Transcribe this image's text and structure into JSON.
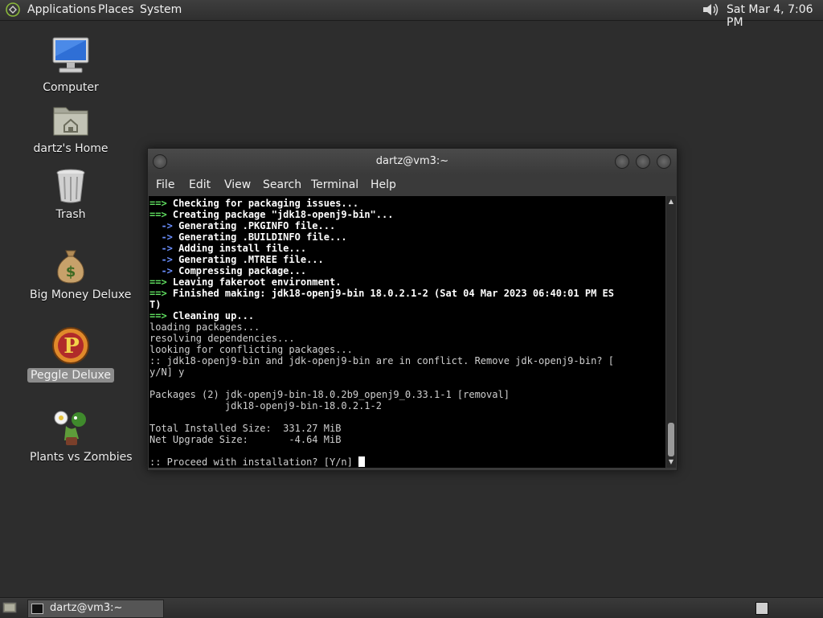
{
  "top_panel": {
    "menus": [
      "Applications",
      "Places",
      "System"
    ],
    "clock": "Sat Mar  4,  7:06 PM",
    "volume_icon": "speaker-icon"
  },
  "desktop_icons": [
    {
      "label": "Computer",
      "icon": "computer-icon"
    },
    {
      "label": "dartz's Home",
      "icon": "home-folder-icon"
    },
    {
      "label": "Trash",
      "icon": "trash-icon"
    },
    {
      "label": "Big Money Deluxe",
      "icon": "money-bag-icon"
    },
    {
      "label": "Peggle Deluxe",
      "icon": "peggle-icon",
      "selected": true
    },
    {
      "label": "Plants vs Zombies",
      "icon": "plants-vs-zombies-icon"
    }
  ],
  "terminal": {
    "title": "dartz@vm3:~",
    "menu": [
      "File",
      "Edit",
      "View",
      "Search",
      "Terminal",
      "Help"
    ],
    "lines": [
      {
        "prefix": "==> ",
        "prefix_color": "green",
        "text": "Checking for packaging issues...",
        "bold": true
      },
      {
        "prefix": "==> ",
        "prefix_color": "green",
        "text": "Creating package \"jdk18-openj9-bin\"...",
        "bold": true
      },
      {
        "prefix": "  -> ",
        "prefix_color": "blue",
        "text": "Generating .PKGINFO file...",
        "bold": true
      },
      {
        "prefix": "  -> ",
        "prefix_color": "blue",
        "text": "Generating .BUILDINFO file...",
        "bold": true
      },
      {
        "prefix": "  -> ",
        "prefix_color": "blue",
        "text": "Adding install file...",
        "bold": true
      },
      {
        "prefix": "  -> ",
        "prefix_color": "blue",
        "text": "Generating .MTREE file...",
        "bold": true
      },
      {
        "prefix": "  -> ",
        "prefix_color": "blue",
        "text": "Compressing package...",
        "bold": true
      },
      {
        "prefix": "==> ",
        "prefix_color": "green",
        "text": "Leaving fakeroot environment.",
        "bold": true
      },
      {
        "prefix": "==> ",
        "prefix_color": "green",
        "text": "Finished making: jdk18-openj9-bin 18.0.2.1-2 (Sat 04 Mar 2023 06:40:01 PM ES",
        "bold": true
      },
      {
        "prefix": "",
        "prefix_color": "",
        "text": "T)",
        "bold": true
      },
      {
        "prefix": "==> ",
        "prefix_color": "green",
        "text": "Cleaning up...",
        "bold": true
      },
      {
        "prefix": "",
        "prefix_color": "",
        "text": "loading packages...",
        "bold": false
      },
      {
        "prefix": "",
        "prefix_color": "",
        "text": "resolving dependencies...",
        "bold": false
      },
      {
        "prefix": "",
        "prefix_color": "",
        "text": "looking for conflicting packages...",
        "bold": false
      },
      {
        "prefix": "",
        "prefix_color": "",
        "text": ":: jdk18-openj9-bin and jdk-openj9-bin are in conflict. Remove jdk-openj9-bin? [",
        "bold": false
      },
      {
        "prefix": "",
        "prefix_color": "",
        "text": "y/N] y",
        "bold": false
      },
      {
        "prefix": "",
        "prefix_color": "",
        "text": "",
        "bold": false
      },
      {
        "prefix": "",
        "prefix_color": "",
        "text": "Packages (2) jdk-openj9-bin-18.0.2b9_openj9_0.33.1-1 [removal]",
        "bold": false
      },
      {
        "prefix": "",
        "prefix_color": "",
        "text": "             jdk18-openj9-bin-18.0.2.1-2",
        "bold": false
      },
      {
        "prefix": "",
        "prefix_color": "",
        "text": "",
        "bold": false
      },
      {
        "prefix": "",
        "prefix_color": "",
        "text": "Total Installed Size:  331.27 MiB",
        "bold": false
      },
      {
        "prefix": "",
        "prefix_color": "",
        "text": "Net Upgrade Size:       -4.64 MiB",
        "bold": false
      },
      {
        "prefix": "",
        "prefix_color": "",
        "text": "",
        "bold": false
      },
      {
        "prefix": "",
        "prefix_color": "",
        "text": ":: Proceed with installation? [Y/n] ",
        "bold": false,
        "cursor": true
      }
    ]
  },
  "bottom_panel": {
    "task_label": "dartz@vm3:~"
  }
}
